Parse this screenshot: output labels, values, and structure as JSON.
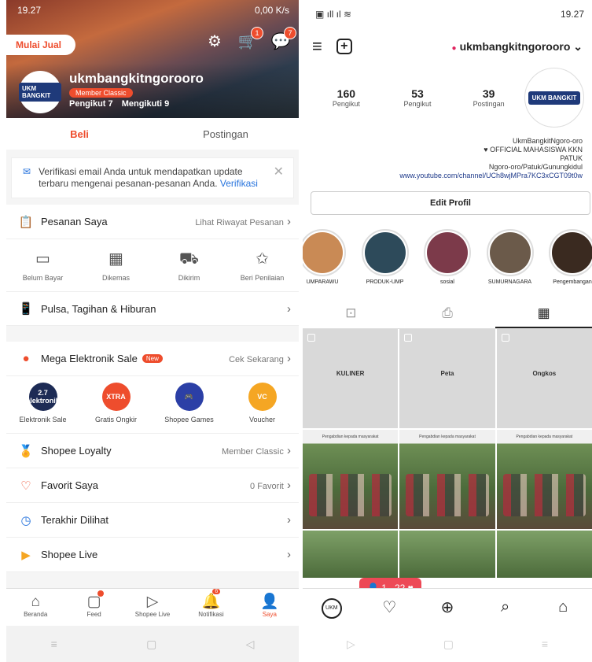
{
  "left": {
    "status": {
      "time": "19.27",
      "right": "0,00 K/s"
    },
    "header": {
      "sell_button": "Mulai Jual",
      "username": "ukmbangkitngorooro",
      "member_badge": "Member Classic",
      "followers": "Pengikut 7",
      "following": "Mengikuti 9",
      "cart_badge": "1",
      "chat_badge": "7",
      "avatar_text": "UKM BANGKIT"
    },
    "tabs": [
      "Beli",
      "Postingan"
    ],
    "verify": {
      "text": "Verifikasi email Anda untuk mendapatkan update terbaru mengenai pesanan-pesanan Anda. ",
      "link": "Verifikasi"
    },
    "orders": {
      "label": "Pesanan Saya",
      "right": "Lihat Riwayat Pesanan"
    },
    "order_states": [
      "Belum Bayar",
      "Dikemas",
      "Dikirim",
      "Beri Penilaian"
    ],
    "pulsa": "Pulsa, Tagihan & Hiburan",
    "mega": {
      "label": "Mega Elektronik Sale",
      "badge": "New",
      "right": "Cek Sekarang"
    },
    "promos": [
      {
        "label": "Elektronik Sale",
        "icon": "2.7 elektronik",
        "color": "#1d2b55"
      },
      {
        "label": "Gratis Ongkir",
        "icon": "XTRA",
        "color": "#ee4d2d"
      },
      {
        "label": "Shopee Games",
        "icon": "🎮",
        "color": "#2b3fa6"
      },
      {
        "label": "Voucher",
        "icon": "VC",
        "color": "#f5a623"
      }
    ],
    "menu": [
      {
        "label": "Shopee Loyalty",
        "right": "Member Classic",
        "icon": "🏅"
      },
      {
        "label": "Favorit Saya",
        "right": "0 Favorit",
        "icon": "♡"
      },
      {
        "label": "Terakhir Dilihat",
        "right": "",
        "icon": "◷"
      },
      {
        "label": "Shopee Live",
        "right": "",
        "icon": "▶"
      }
    ],
    "nav": [
      {
        "label": "Beranda",
        "icon": "⌂"
      },
      {
        "label": "Feed",
        "icon": "▢"
      },
      {
        "label": "Shopee Live",
        "icon": "▷"
      },
      {
        "label": "Notifikasi",
        "icon": "🔔",
        "count": "6"
      },
      {
        "label": "Saya",
        "icon": "👤"
      }
    ]
  },
  "right": {
    "status": {
      "time": "19.27"
    },
    "username": "ukmbangkitngorooro",
    "stats": [
      {
        "num": "160",
        "label": "Pengikut"
      },
      {
        "num": "53",
        "label": "Pengikut"
      },
      {
        "num": "39",
        "label": "Postingan"
      }
    ],
    "avatar_text": "UKM BANGKIT",
    "bio": [
      "UkmBangkitNgoro-oro",
      "♥ OFFICIAL MAHASISWA KKN",
      "PATUK",
      "Ngoro-oro/Patuk/Gunungkidul",
      "www.youtube.com/channel/UCh8wjMPra7KC3xCGT09t0w"
    ],
    "edit_profile": "Edit Profil",
    "stories": [
      {
        "label": "UMPARAWU",
        "color": "#c98a55"
      },
      {
        "label": "PRODUK-UMP",
        "color": "#2d4a5a"
      },
      {
        "label": "sosial",
        "color": "#7c3a4a"
      },
      {
        "label": "SUMURNAGARA",
        "color": "#6b5a4a"
      },
      {
        "label": "Pengembangan",
        "color": "#3a2a20"
      }
    ],
    "posts_gray": [
      "KULINER",
      "Peta",
      "Ongkos"
    ],
    "post_caption": "Pengabdian kepada masyarakat",
    "notif": {
      "followers": "1",
      "likes": "22"
    },
    "nav": [
      "UKM",
      "♡",
      "⊕",
      "⌕",
      "⌂"
    ]
  }
}
